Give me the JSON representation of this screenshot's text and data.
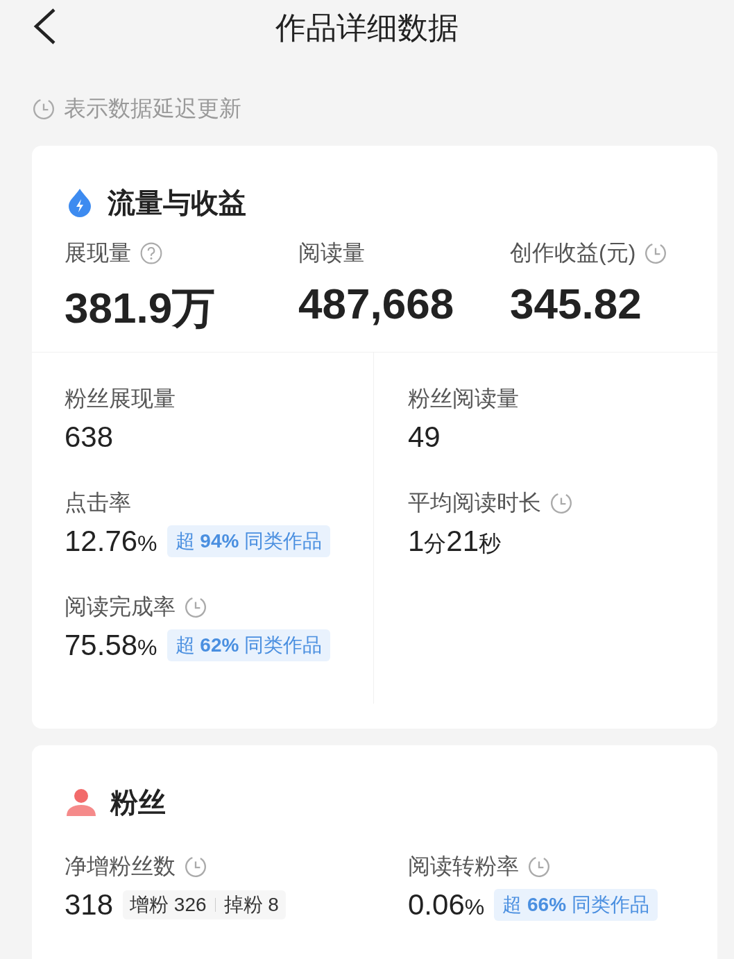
{
  "header": {
    "title": "作品详细数据"
  },
  "notice": {
    "text": "表示数据延迟更新"
  },
  "traffic_card": {
    "title": "流量与收益",
    "top_metrics": [
      {
        "label": "展现量",
        "kind": "help",
        "value": "381.9万"
      },
      {
        "label": "阅读量",
        "kind": "plain",
        "value": "487,668"
      },
      {
        "label": "创作收益(元)",
        "kind": "delayed",
        "value": "345.82"
      }
    ],
    "left_metrics": [
      {
        "label": "粉丝展现量",
        "kind": "plain",
        "value": [
          {
            "text": "638",
            "kind": "num"
          }
        ]
      },
      {
        "label": "点击率",
        "kind": "plain",
        "value": [
          {
            "text": "12.76",
            "kind": "num"
          },
          {
            "text": "%",
            "kind": "unit"
          }
        ],
        "badge": "超 **94%** 同类作品"
      },
      {
        "label": "阅读完成率",
        "kind": "delayed",
        "value": [
          {
            "text": "75.58",
            "kind": "num"
          },
          {
            "text": "%",
            "kind": "unit"
          }
        ],
        "badge": "超 **62%** 同类作品"
      }
    ],
    "right_metrics": [
      {
        "label": "粉丝阅读量",
        "kind": "plain",
        "value": [
          {
            "text": "49",
            "kind": "num"
          }
        ]
      },
      {
        "label": "平均阅读时长",
        "kind": "delayed",
        "value": [
          {
            "text": "1",
            "kind": "num"
          },
          {
            "text": "分",
            "kind": "unit"
          },
          {
            "text": "21",
            "kind": "num"
          },
          {
            "text": "秒",
            "kind": "unit"
          }
        ]
      }
    ]
  },
  "fans_card": {
    "title": "粉丝",
    "metrics": [
      {
        "label": "净增粉丝数",
        "kind": "delayed",
        "value": [
          {
            "text": "318",
            "kind": "num"
          }
        ],
        "breakdown": [
          "增粉 326",
          "掉粉 8"
        ]
      },
      {
        "label": "阅读转粉率",
        "kind": "delayed",
        "value": [
          {
            "text": "0.06",
            "kind": "num"
          },
          {
            "text": "%",
            "kind": "unit"
          }
        ],
        "badge": "超 **66%** 同类作品"
      }
    ]
  }
}
